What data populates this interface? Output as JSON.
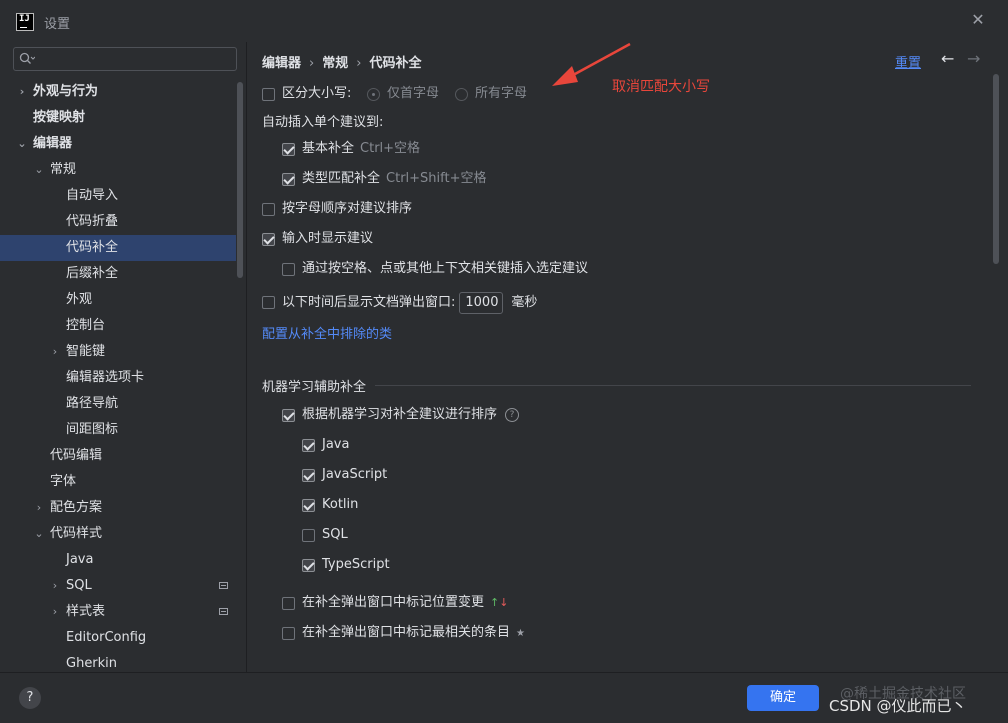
{
  "window": {
    "title": "设置",
    "app_icon": "IJ"
  },
  "search": {
    "placeholder": ""
  },
  "sidebar": {
    "items": [
      {
        "label": "外观与行为"
      },
      {
        "label": "按键映射"
      },
      {
        "label": "编辑器"
      },
      {
        "label": "常规"
      },
      {
        "label": "自动导入"
      },
      {
        "label": "代码折叠"
      },
      {
        "label": "代码补全"
      },
      {
        "label": "后缀补全"
      },
      {
        "label": "外观"
      },
      {
        "label": "控制台"
      },
      {
        "label": "智能键"
      },
      {
        "label": "编辑器选项卡"
      },
      {
        "label": "路径导航"
      },
      {
        "label": "间距图标"
      },
      {
        "label": "代码编辑"
      },
      {
        "label": "字体"
      },
      {
        "label": "配色方案"
      },
      {
        "label": "代码样式"
      },
      {
        "label": "Java"
      },
      {
        "label": "SQL"
      },
      {
        "label": "样式表"
      },
      {
        "label": "EditorConfig"
      },
      {
        "label": "Gherkin"
      }
    ]
  },
  "header": {
    "breadcrumb": [
      "编辑器",
      "常规",
      "代码补全"
    ],
    "reset": "重置"
  },
  "options": {
    "case_sensitive": {
      "label": "区分大小写:",
      "checked": false
    },
    "first_letter": {
      "label": "仅首字母"
    },
    "all_letters": {
      "label": "所有字母"
    },
    "auto_insert_title": "自动插入单个建议到:",
    "basic": {
      "label": "基本补全",
      "shortcut": "Ctrl+空格",
      "checked": true
    },
    "type_match": {
      "label": "类型匹配补全",
      "shortcut": "Ctrl+Shift+空格",
      "checked": true
    },
    "sort_alpha": {
      "label": "按字母顺序对建议排序",
      "checked": false
    },
    "show_typing": {
      "label": "输入时显示建议",
      "checked": true
    },
    "insert_by_space": {
      "label": "通过按空格、点或其他上下文相关键插入选定建议",
      "checked": false
    },
    "doc_popup": {
      "label": "以下时间后显示文档弹出窗口:",
      "value": "1000",
      "unit": "毫秒",
      "checked": false
    },
    "exclude_link": "配置从补全中排除的类"
  },
  "ml": {
    "title": "机器学习辅助补全",
    "sort": {
      "label": "根据机器学习对补全建议进行排序",
      "checked": true
    },
    "languages": [
      {
        "label": "Java",
        "checked": true
      },
      {
        "label": "JavaScript",
        "checked": true
      },
      {
        "label": "Kotlin",
        "checked": true
      },
      {
        "label": "SQL",
        "checked": false
      },
      {
        "label": "TypeScript",
        "checked": true
      }
    ],
    "mark_position": {
      "label": "在补全弹出窗口中标记位置变更",
      "checked": false
    },
    "mark_relevant": {
      "label": "在补全弹出窗口中标记最相关的条目",
      "checked": false
    }
  },
  "annotation": {
    "text": "取消匹配大小写",
    "color": "#e8463b"
  },
  "footer": {
    "help": "?",
    "ok": "确定",
    "watermark_top": "@稀土掘金技术社区",
    "watermark_bottom": "CSDN @仪此而已丶"
  },
  "colors": {
    "accent": "#3574f0",
    "link": "#548af7",
    "selection": "#2e436e",
    "background": "#2b2d30"
  }
}
